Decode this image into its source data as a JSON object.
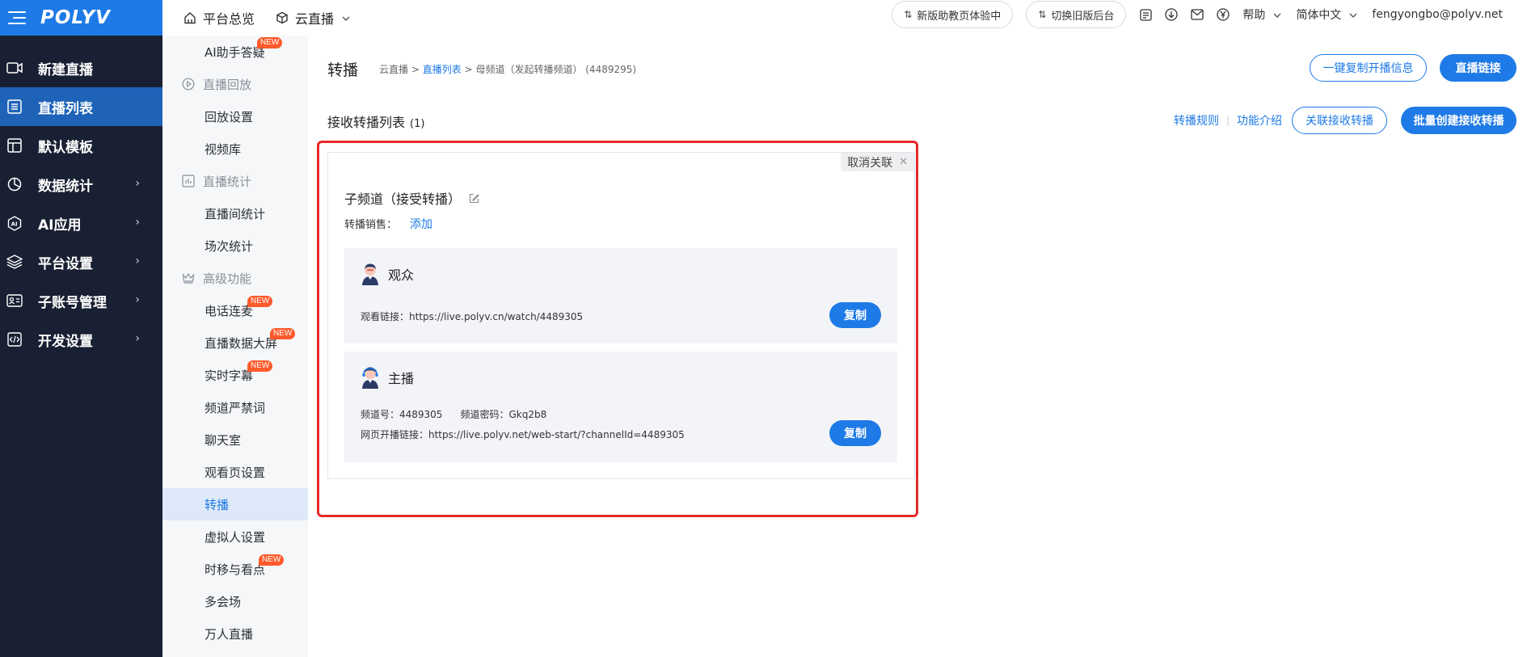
{
  "brand": {
    "logo": "POLYV"
  },
  "nav": {
    "items": [
      {
        "label": "新建直播",
        "icon": "video-camera-icon",
        "arrow": ""
      },
      {
        "label": "直播列表",
        "icon": "list-icon",
        "arrow": ""
      },
      {
        "label": "默认模板",
        "icon": "template-icon",
        "arrow": ""
      },
      {
        "label": "数据统计",
        "icon": "pie-chart-icon",
        "arrow": "›"
      },
      {
        "label": "AI应用",
        "icon": "ai-hexagon-icon",
        "arrow": "›"
      },
      {
        "label": "平台设置",
        "icon": "layers-icon",
        "arrow": "›"
      },
      {
        "label": "子账号管理",
        "icon": "id-card-icon",
        "arrow": "›"
      },
      {
        "label": "开发设置",
        "icon": "code-icon",
        "arrow": "›"
      }
    ]
  },
  "subnav": {
    "top_item": {
      "label": "AI助手答疑",
      "badge": "NEW"
    },
    "group_replay": {
      "label": "直播回放",
      "icon": "play-circle-icon"
    },
    "replay_items": [
      "回放设置",
      "视频库"
    ],
    "group_stats": {
      "label": "直播统计",
      "icon": "bar-chart-icon"
    },
    "stats_items": [
      "直播间统计",
      "场次统计"
    ],
    "group_advanced": {
      "label": "高级功能",
      "icon": "crown-icon"
    },
    "advanced_items": [
      {
        "label": "电话连麦",
        "badge": "NEW"
      },
      {
        "label": "直播数据大屏",
        "badge": "NEW"
      },
      {
        "label": "实时字幕",
        "badge": "NEW"
      },
      {
        "label": "频道严禁词",
        "badge": ""
      },
      {
        "label": "聊天室",
        "badge": ""
      },
      {
        "label": "观看页设置",
        "badge": ""
      },
      {
        "label": "转播",
        "badge": ""
      },
      {
        "label": "虚拟人设置",
        "badge": ""
      },
      {
        "label": "时移与看点",
        "badge": "NEW"
      },
      {
        "label": "多会场",
        "badge": ""
      },
      {
        "label": "万人直播",
        "badge": ""
      }
    ]
  },
  "topbar": {
    "home_label": "平台总览",
    "live_label": "云直播",
    "new_guide_label": "新版助教页体验中",
    "switch_old_label": "切换旧版后台",
    "help_label": "帮助",
    "lang_label": "简体中文",
    "user_email": "fengyongbo@polyv.net"
  },
  "page": {
    "title": "转播",
    "breadcrumb": {
      "root": "云直播 >",
      "list": "直播列表",
      "sep": ">",
      "current": "母频道（发起转播频道） (4489295)"
    },
    "copy_info_button": "一键复制开播信息",
    "live_link_button": "直播链接",
    "section_title": "接收转播列表",
    "section_count": "(1)",
    "rules_link": "转播规则",
    "rules_sep": "|",
    "intro_link": "功能介绍",
    "link_receive_button": "关联接收转播",
    "batch_create_button": "批量创建接收转播"
  },
  "card": {
    "unlink_label": "取消关联",
    "child_title": "子频道（接受转播）",
    "sale_label": "转播销售：",
    "sale_add": "添加",
    "audience": {
      "title": "观众",
      "watch_link": "观看链接：https://live.polyv.cn/watch/4489305",
      "copy_label": "复制"
    },
    "host": {
      "title": "主播",
      "channel_no": "频道号：4489305",
      "channel_pwd": "频道密码：Gkq2b8",
      "web_start": "网页开播链接：https://live.polyv.net/web-start/?channelId=4489305",
      "copy_label": "复制"
    }
  },
  "colors": {
    "brand_blue": "#1e7ae6",
    "nav_bg": "#1a2033",
    "highlight_red": "#e52a2a",
    "new_badge": "#ff5a2b"
  }
}
